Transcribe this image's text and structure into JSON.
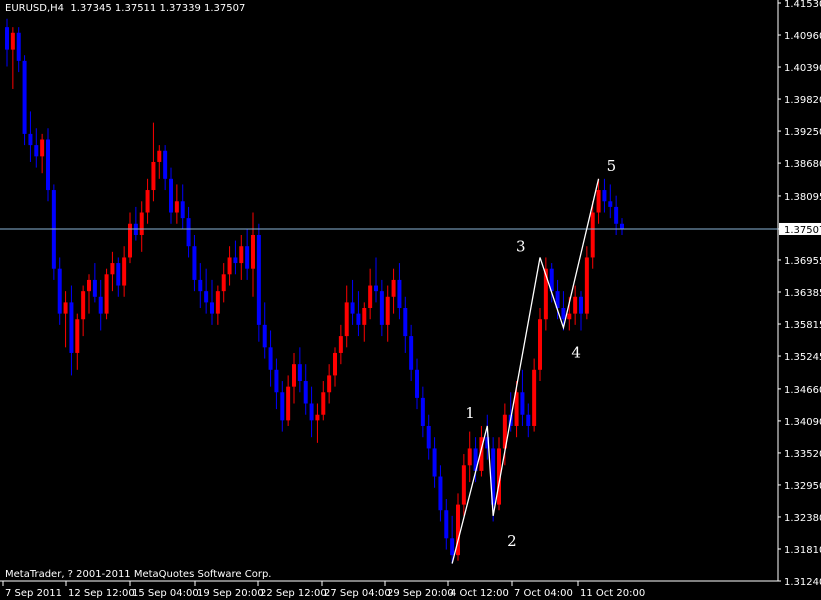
{
  "header": {
    "symbol": "EURUSD,H4",
    "open": "1.37345",
    "high": "1.37511",
    "low": "1.37339",
    "close": "1.37507"
  },
  "footer": {
    "copyright": "MetaTrader, ? 2001-2011 MetaQuotes Software Corp."
  },
  "chart_data": {
    "type": "candlestick",
    "title": "EURUSD,H4",
    "ylim": [
      1.3124,
      1.4153
    ],
    "y_ticks": [
      "1.41530",
      "1.40960",
      "1.40390",
      "1.39820",
      "1.39250",
      "1.38680",
      "1.38095",
      "1.37507",
      "1.36955",
      "1.36385",
      "1.35815",
      "1.35245",
      "1.34660",
      "1.34090",
      "1.33520",
      "1.32950",
      "1.32380",
      "1.31810",
      "1.31240"
    ],
    "current_price": "1.37507",
    "x_tick_labels": [
      "7 Sep 2011",
      "12 Sep 12:00",
      "15 Sep 04:00",
      "19 Sep 20:00",
      "22 Sep 12:00",
      "27 Sep 04:00",
      "29 Sep 20:00",
      "4 Oct 12:00",
      "7 Oct 04:00",
      "11 Oct 20:00"
    ],
    "colors": {
      "bull": "#ff0000",
      "bear": "#0000ff",
      "wave": "#ffffff",
      "price_line": "#8ab4d6",
      "axis": "#ffffff"
    },
    "candles": [
      {
        "o": 1.411,
        "h": 1.4125,
        "l": 1.404,
        "c": 1.407
      },
      {
        "o": 1.407,
        "h": 1.411,
        "l": 1.4,
        "c": 1.41
      },
      {
        "o": 1.41,
        "h": 1.411,
        "l": 1.403,
        "c": 1.405
      },
      {
        "o": 1.405,
        "h": 1.406,
        "l": 1.39,
        "c": 1.392
      },
      {
        "o": 1.392,
        "h": 1.396,
        "l": 1.387,
        "c": 1.39
      },
      {
        "o": 1.39,
        "h": 1.393,
        "l": 1.386,
        "c": 1.388
      },
      {
        "o": 1.388,
        "h": 1.392,
        "l": 1.385,
        "c": 1.391
      },
      {
        "o": 1.391,
        "h": 1.393,
        "l": 1.38,
        "c": 1.382
      },
      {
        "o": 1.382,
        "h": 1.383,
        "l": 1.366,
        "c": 1.368
      },
      {
        "o": 1.368,
        "h": 1.37,
        "l": 1.358,
        "c": 1.36
      },
      {
        "o": 1.36,
        "h": 1.364,
        "l": 1.354,
        "c": 1.362
      },
      {
        "o": 1.362,
        "h": 1.365,
        "l": 1.349,
        "c": 1.353
      },
      {
        "o": 1.353,
        "h": 1.36,
        "l": 1.35,
        "c": 1.359
      },
      {
        "o": 1.359,
        "h": 1.365,
        "l": 1.356,
        "c": 1.364
      },
      {
        "o": 1.364,
        "h": 1.367,
        "l": 1.36,
        "c": 1.366
      },
      {
        "o": 1.366,
        "h": 1.369,
        "l": 1.362,
        "c": 1.363
      },
      {
        "o": 1.363,
        "h": 1.366,
        "l": 1.357,
        "c": 1.36
      },
      {
        "o": 1.36,
        "h": 1.368,
        "l": 1.359,
        "c": 1.367
      },
      {
        "o": 1.367,
        "h": 1.371,
        "l": 1.364,
        "c": 1.369
      },
      {
        "o": 1.369,
        "h": 1.37,
        "l": 1.363,
        "c": 1.365
      },
      {
        "o": 1.365,
        "h": 1.372,
        "l": 1.363,
        "c": 1.37
      },
      {
        "o": 1.37,
        "h": 1.378,
        "l": 1.369,
        "c": 1.376
      },
      {
        "o": 1.376,
        "h": 1.379,
        "l": 1.373,
        "c": 1.374
      },
      {
        "o": 1.374,
        "h": 1.38,
        "l": 1.371,
        "c": 1.378
      },
      {
        "o": 1.378,
        "h": 1.384,
        "l": 1.376,
        "c": 1.382
      },
      {
        "o": 1.382,
        "h": 1.394,
        "l": 1.38,
        "c": 1.387
      },
      {
        "o": 1.387,
        "h": 1.39,
        "l": 1.384,
        "c": 1.389
      },
      {
        "o": 1.389,
        "h": 1.39,
        "l": 1.382,
        "c": 1.384
      },
      {
        "o": 1.384,
        "h": 1.386,
        "l": 1.376,
        "c": 1.378
      },
      {
        "o": 1.378,
        "h": 1.383,
        "l": 1.376,
        "c": 1.38
      },
      {
        "o": 1.38,
        "h": 1.383,
        "l": 1.375,
        "c": 1.377
      },
      {
        "o": 1.377,
        "h": 1.379,
        "l": 1.37,
        "c": 1.372
      },
      {
        "o": 1.372,
        "h": 1.374,
        "l": 1.364,
        "c": 1.366
      },
      {
        "o": 1.366,
        "h": 1.369,
        "l": 1.361,
        "c": 1.364
      },
      {
        "o": 1.364,
        "h": 1.368,
        "l": 1.36,
        "c": 1.362
      },
      {
        "o": 1.362,
        "h": 1.366,
        "l": 1.358,
        "c": 1.36
      },
      {
        "o": 1.36,
        "h": 1.365,
        "l": 1.358,
        "c": 1.364
      },
      {
        "o": 1.364,
        "h": 1.369,
        "l": 1.362,
        "c": 1.367
      },
      {
        "o": 1.367,
        "h": 1.372,
        "l": 1.365,
        "c": 1.37
      },
      {
        "o": 1.37,
        "h": 1.373,
        "l": 1.367,
        "c": 1.369
      },
      {
        "o": 1.369,
        "h": 1.374,
        "l": 1.366,
        "c": 1.372
      },
      {
        "o": 1.372,
        "h": 1.375,
        "l": 1.366,
        "c": 1.368
      },
      {
        "o": 1.368,
        "h": 1.378,
        "l": 1.363,
        "c": 1.374
      },
      {
        "o": 1.374,
        "h": 1.376,
        "l": 1.355,
        "c": 1.358
      },
      {
        "o": 1.358,
        "h": 1.362,
        "l": 1.352,
        "c": 1.354
      },
      {
        "o": 1.354,
        "h": 1.357,
        "l": 1.347,
        "c": 1.35
      },
      {
        "o": 1.35,
        "h": 1.352,
        "l": 1.343,
        "c": 1.346
      },
      {
        "o": 1.346,
        "h": 1.348,
        "l": 1.339,
        "c": 1.341
      },
      {
        "o": 1.341,
        "h": 1.349,
        "l": 1.34,
        "c": 1.347
      },
      {
        "o": 1.347,
        "h": 1.353,
        "l": 1.344,
        "c": 1.351
      },
      {
        "o": 1.351,
        "h": 1.354,
        "l": 1.346,
        "c": 1.348
      },
      {
        "o": 1.348,
        "h": 1.351,
        "l": 1.342,
        "c": 1.344
      },
      {
        "o": 1.344,
        "h": 1.347,
        "l": 1.338,
        "c": 1.341
      },
      {
        "o": 1.341,
        "h": 1.344,
        "l": 1.337,
        "c": 1.342
      },
      {
        "o": 1.342,
        "h": 1.348,
        "l": 1.341,
        "c": 1.346
      },
      {
        "o": 1.346,
        "h": 1.351,
        "l": 1.344,
        "c": 1.349
      },
      {
        "o": 1.349,
        "h": 1.354,
        "l": 1.347,
        "c": 1.353
      },
      {
        "o": 1.353,
        "h": 1.358,
        "l": 1.351,
        "c": 1.356
      },
      {
        "o": 1.356,
        "h": 1.365,
        "l": 1.354,
        "c": 1.362
      },
      {
        "o": 1.362,
        "h": 1.366,
        "l": 1.358,
        "c": 1.36
      },
      {
        "o": 1.36,
        "h": 1.364,
        "l": 1.356,
        "c": 1.358
      },
      {
        "o": 1.358,
        "h": 1.362,
        "l": 1.355,
        "c": 1.361
      },
      {
        "o": 1.361,
        "h": 1.368,
        "l": 1.359,
        "c": 1.365
      },
      {
        "o": 1.365,
        "h": 1.37,
        "l": 1.362,
        "c": 1.364
      },
      {
        "o": 1.364,
        "h": 1.366,
        "l": 1.356,
        "c": 1.358
      },
      {
        "o": 1.358,
        "h": 1.365,
        "l": 1.355,
        "c": 1.363
      },
      {
        "o": 1.363,
        "h": 1.368,
        "l": 1.36,
        "c": 1.366
      },
      {
        "o": 1.366,
        "h": 1.369,
        "l": 1.359,
        "c": 1.361
      },
      {
        "o": 1.361,
        "h": 1.363,
        "l": 1.353,
        "c": 1.356
      },
      {
        "o": 1.356,
        "h": 1.358,
        "l": 1.348,
        "c": 1.35
      },
      {
        "o": 1.35,
        "h": 1.352,
        "l": 1.343,
        "c": 1.345
      },
      {
        "o": 1.345,
        "h": 1.347,
        "l": 1.338,
        "c": 1.34
      },
      {
        "o": 1.34,
        "h": 1.342,
        "l": 1.334,
        "c": 1.336
      },
      {
        "o": 1.336,
        "h": 1.338,
        "l": 1.329,
        "c": 1.331
      },
      {
        "o": 1.331,
        "h": 1.333,
        "l": 1.323,
        "c": 1.325
      },
      {
        "o": 1.325,
        "h": 1.327,
        "l": 1.318,
        "c": 1.32
      },
      {
        "o": 1.32,
        "h": 1.324,
        "l": 1.3155,
        "c": 1.317
      },
      {
        "o": 1.317,
        "h": 1.328,
        "l": 1.316,
        "c": 1.326
      },
      {
        "o": 1.326,
        "h": 1.335,
        "l": 1.324,
        "c": 1.333
      },
      {
        "o": 1.333,
        "h": 1.339,
        "l": 1.33,
        "c": 1.336
      },
      {
        "o": 1.336,
        "h": 1.338,
        "l": 1.33,
        "c": 1.332
      },
      {
        "o": 1.332,
        "h": 1.34,
        "l": 1.331,
        "c": 1.338
      },
      {
        "o": 1.338,
        "h": 1.342,
        "l": 1.334,
        "c": 1.336
      },
      {
        "o": 1.336,
        "h": 1.338,
        "l": 1.323,
        "c": 1.326
      },
      {
        "o": 1.326,
        "h": 1.338,
        "l": 1.325,
        "c": 1.336
      },
      {
        "o": 1.336,
        "h": 1.344,
        "l": 1.333,
        "c": 1.342
      },
      {
        "o": 1.342,
        "h": 1.346,
        "l": 1.339,
        "c": 1.34
      },
      {
        "o": 1.34,
        "h": 1.348,
        "l": 1.338,
        "c": 1.346
      },
      {
        "o": 1.346,
        "h": 1.35,
        "l": 1.34,
        "c": 1.342
      },
      {
        "o": 1.342,
        "h": 1.344,
        "l": 1.338,
        "c": 1.34
      },
      {
        "o": 1.34,
        "h": 1.352,
        "l": 1.339,
        "c": 1.35
      },
      {
        "o": 1.35,
        "h": 1.361,
        "l": 1.348,
        "c": 1.359
      },
      {
        "o": 1.359,
        "h": 1.37,
        "l": 1.357,
        "c": 1.368
      },
      {
        "o": 1.368,
        "h": 1.369,
        "l": 1.362,
        "c": 1.364
      },
      {
        "o": 1.364,
        "h": 1.366,
        "l": 1.359,
        "c": 1.361
      },
      {
        "o": 1.361,
        "h": 1.364,
        "l": 1.357,
        "c": 1.359
      },
      {
        "o": 1.359,
        "h": 1.363,
        "l": 1.357,
        "c": 1.36
      },
      {
        "o": 1.36,
        "h": 1.365,
        "l": 1.358,
        "c": 1.363
      },
      {
        "o": 1.363,
        "h": 1.364,
        "l": 1.357,
        "c": 1.36
      },
      {
        "o": 1.36,
        "h": 1.372,
        "l": 1.359,
        "c": 1.37
      },
      {
        "o": 1.37,
        "h": 1.38,
        "l": 1.368,
        "c": 1.378
      },
      {
        "o": 1.378,
        "h": 1.384,
        "l": 1.376,
        "c": 1.382
      },
      {
        "o": 1.382,
        "h": 1.384,
        "l": 1.378,
        "c": 1.38
      },
      {
        "o": 1.38,
        "h": 1.383,
        "l": 1.377,
        "c": 1.379
      },
      {
        "o": 1.379,
        "h": 1.381,
        "l": 1.374,
        "c": 1.376
      },
      {
        "o": 1.376,
        "h": 1.377,
        "l": 1.374,
        "c": 1.3751
      }
    ],
    "wave_points": [
      {
        "label": "",
        "candle": 76,
        "price": 1.3155
      },
      {
        "label": "1",
        "candle": 82,
        "price": 1.34
      },
      {
        "label": "2",
        "candle": 83,
        "price": 1.324
      },
      {
        "label": "3",
        "candle": 91,
        "price": 1.37
      },
      {
        "label": "4",
        "candle": 95,
        "price": 1.3575
      },
      {
        "label": "5",
        "candle": 101,
        "price": 1.384
      }
    ]
  }
}
